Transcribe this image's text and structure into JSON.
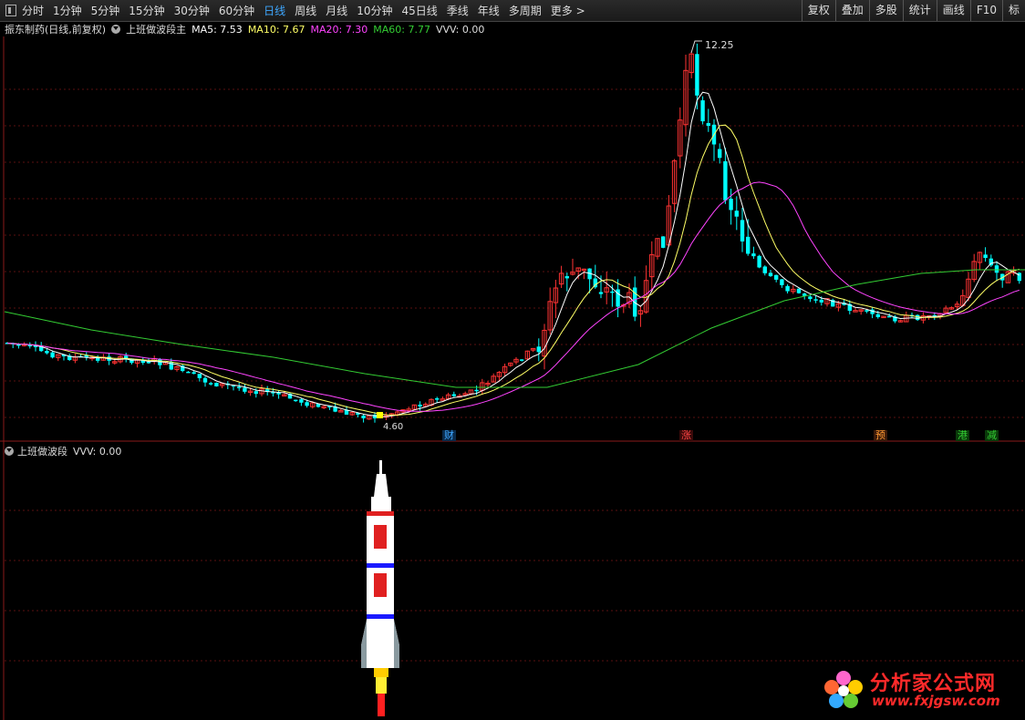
{
  "toolbar": {
    "periods": [
      "分时",
      "1分钟",
      "5分钟",
      "15分钟",
      "30分钟",
      "60分钟",
      "日线",
      "周线",
      "月线",
      "10分钟",
      "45日线",
      "季线",
      "年线",
      "多周期",
      "更多 >"
    ],
    "active": "日线",
    "right_buttons": [
      "复权",
      "叠加",
      "多股",
      "统计",
      "画线",
      "F10",
      "标"
    ]
  },
  "main_panel": {
    "stock_name": "振东制药(日线,前复权)",
    "indicator": "上班做波段主",
    "ma5_label": "MA5: 7.53",
    "ma10_label": "MA10: 7.67",
    "ma20_label": "MA20: 7.30",
    "ma60_label": "MA60: 7.77",
    "vvv_label": "VVV: 0.00",
    "high_label": "12.25",
    "low_label": "4.60",
    "colors": {
      "ma5": "#ffffff",
      "ma10": "#ffff66",
      "ma20": "#ff44ff",
      "ma60": "#33cc33",
      "up": "#ff3333",
      "down": "#00ffff"
    }
  },
  "event_hints": [
    {
      "text": "财",
      "color": "#3ea7ff"
    },
    {
      "text": "涨",
      "color": "#ff4444"
    },
    {
      "text": "预",
      "color": "#ff9933"
    },
    {
      "text": "港",
      "color": "#33cc33"
    },
    {
      "text": "减",
      "color": "#33cc33"
    }
  ],
  "sub_panel": {
    "indicator": "上班做波段",
    "vvv_label": "VVV: 0.00"
  },
  "watermark": {
    "title": "分析家公式网",
    "url": "www.fxjgsw.com"
  }
}
